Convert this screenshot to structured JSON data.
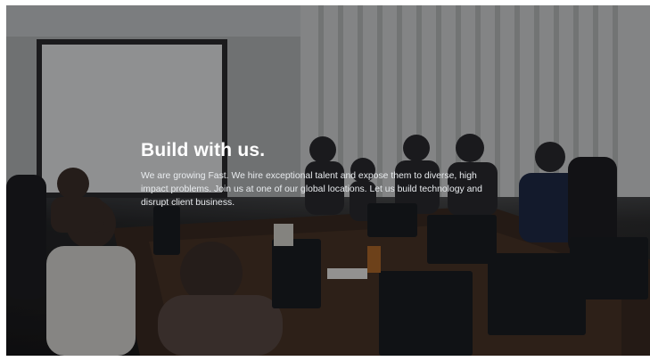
{
  "hero": {
    "title": "Build with us.",
    "description": "We are growing Fast. We hire exceptional talent and expose them to diverse, high impact problems. Join us at one of our global locations. Let us build technology and disrupt client business."
  },
  "colors": {
    "overlay": "#000000",
    "title_text": "#ffffff",
    "body_text": "#e9ecef"
  }
}
